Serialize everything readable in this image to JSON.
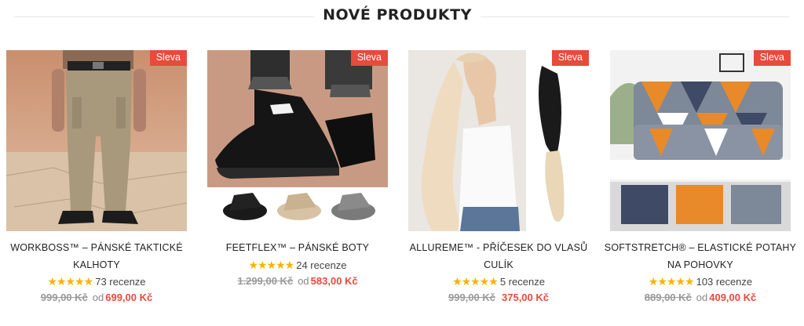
{
  "section": {
    "title": "NOVÉ PRODUKTY"
  },
  "colors": {
    "accent": "#e64b3c",
    "star": "#f5b400"
  },
  "products": [
    {
      "badge": "Sleva",
      "title_line1": "WORKBOSS™ – PÁNSKÉ TAKTICKÉ",
      "title_line2": "KALHOTY",
      "stars": "★★★★★",
      "reviews": "73 recenze",
      "old_price": "999,00 Kč",
      "from": "od",
      "price": "699,00 Kč"
    },
    {
      "badge": "Sleva",
      "title_line1": "FEETFLEX™ – PÁNSKÉ BOTY",
      "title_line2": "",
      "stars": "★★★★★",
      "reviews": "24 recenze",
      "old_price": "1.299,00 Kč",
      "from": "od",
      "price": "583,00 Kč"
    },
    {
      "badge": "Sleva",
      "title_line1": "ALLUREME™ - PŘÍČESEK DO VLASŮ",
      "title_line2": "CULÍK",
      "stars": "★★★★★",
      "reviews": "5 recenze",
      "old_price": "999,00 Kč",
      "from": "",
      "price": "375,00 Kč"
    },
    {
      "badge": "Sleva",
      "title_line1": "SOFTSTRETCH® – ELASTICKÉ POTAHY",
      "title_line2": "NA POHOVKY",
      "stars": "★★★★★",
      "reviews": "103 recenze",
      "old_price": "889,00 Kč",
      "from": "od",
      "price": "409,00 Kč"
    }
  ]
}
